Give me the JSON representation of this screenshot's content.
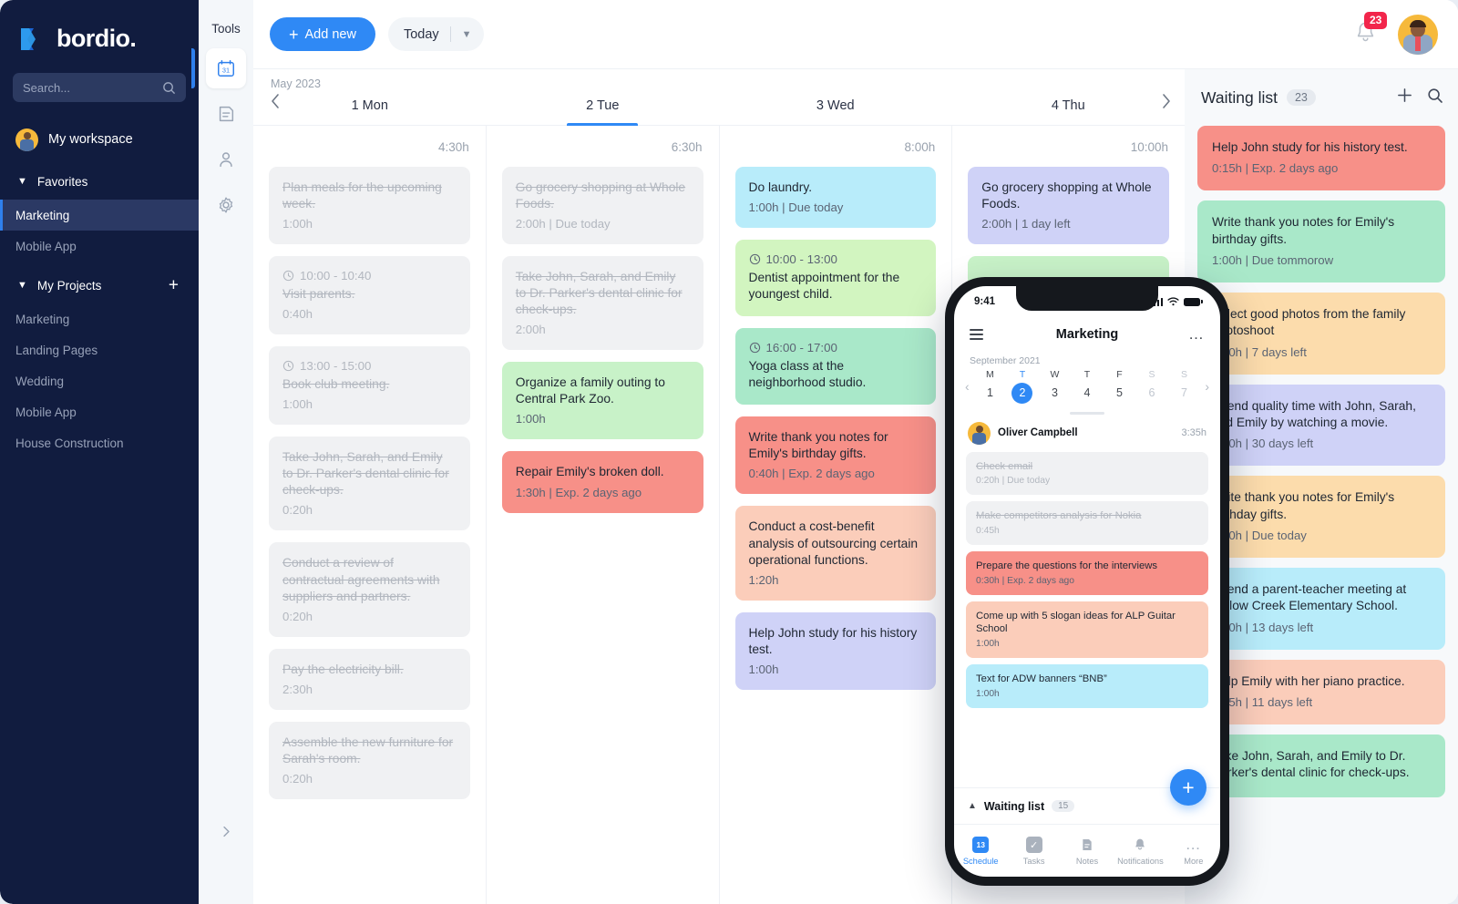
{
  "sidebar": {
    "brand": "bordio.",
    "search_placeholder": "Search...",
    "workspace": "My workspace",
    "favorites_label": "Favorites",
    "favorites": [
      {
        "label": "Marketing",
        "active": true
      },
      {
        "label": "Mobile App",
        "active": false
      }
    ],
    "projects_label": "My Projects",
    "add_project_icon": "plus-icon",
    "projects": [
      {
        "label": "Marketing"
      },
      {
        "label": "Landing Pages"
      },
      {
        "label": "Wedding"
      },
      {
        "label": "Mobile App"
      },
      {
        "label": "House Construction"
      }
    ]
  },
  "tools_rail": {
    "label": "Tools",
    "items": [
      {
        "icon": "calendar-31-icon",
        "active": true
      },
      {
        "icon": "notes-icon",
        "active": false
      },
      {
        "icon": "contacts-icon",
        "active": false
      },
      {
        "icon": "gear-icon",
        "active": false
      }
    ],
    "expand_icon": "chevron-right-icon"
  },
  "topbar": {
    "add_new_label": "Add new",
    "today_label": "Today",
    "notifications_count": "23"
  },
  "daynav": {
    "month": "May 2023",
    "prev_icon": "chevron-left-icon",
    "next_icon": "chevron-right-icon",
    "days": [
      {
        "label": "1 Mon",
        "selected": false
      },
      {
        "label": "2 Tue",
        "selected": true
      },
      {
        "label": "3 Wed",
        "selected": false
      },
      {
        "label": "4 Thu",
        "selected": false
      }
    ]
  },
  "columns": [
    {
      "total": "4:30h",
      "cards": [
        {
          "title": "Plan meals for the upcoming week.",
          "meta": "1:00h",
          "time": "",
          "color": "#f0f1f3",
          "done": true
        },
        {
          "title": "Visit parents.",
          "meta": "0:40h",
          "time": "10:00 - 10:40",
          "color": "#f0f1f3",
          "done": true
        },
        {
          "title": "Book club meeting.",
          "meta": "1:00h",
          "time": "13:00 - 15:00",
          "color": "#f0f1f3",
          "done": true
        },
        {
          "title": "Take John, Sarah, and Emily to Dr. Parker's dental clinic for check-ups.",
          "meta": "0:20h",
          "time": "",
          "color": "#f0f1f3",
          "done": true
        },
        {
          "title": "Conduct a review of contractual agreements with suppliers and partners.",
          "meta": "0:20h",
          "time": "",
          "color": "#f0f1f3",
          "done": true
        },
        {
          "title": "Pay the electricity bill.",
          "meta": "2:30h",
          "time": "",
          "color": "#f0f1f3",
          "done": true
        },
        {
          "title": "Assemble the new furniture for Sarah's room.",
          "meta": "0:20h",
          "time": "",
          "color": "#f0f1f3",
          "done": true
        }
      ]
    },
    {
      "total": "6:30h",
      "cards": [
        {
          "title": "Go grocery shopping at Whole Foods.",
          "meta": "2:00h | Due today",
          "time": "",
          "color": "#f0f1f3",
          "done": true
        },
        {
          "title": "Take John, Sarah, and Emily to Dr. Parker's dental clinic for check-ups.",
          "meta": "2:00h",
          "time": "",
          "color": "#f0f1f3",
          "done": true
        },
        {
          "title": "Organize a family outing to Central Park Zoo.",
          "meta": "1:00h",
          "time": "",
          "color": "#c8f2c8",
          "done": false
        },
        {
          "title": "Repair Emily's broken doll.",
          "meta": "1:30h | Exp. 2 days ago",
          "time": "",
          "color": "#f79088",
          "done": false
        }
      ]
    },
    {
      "total": "8:00h",
      "cards": [
        {
          "title": "Do laundry.",
          "meta": "1:00h | Due today",
          "time": "",
          "color": "#b8ecfa",
          "done": false
        },
        {
          "title": "Dentist appointment for the youngest child.",
          "meta": "",
          "time": "10:00 - 13:00",
          "color": "#d2f5c0",
          "done": false
        },
        {
          "title": "Yoga class at the neighborhood studio.",
          "meta": "",
          "time": "16:00 - 17:00",
          "color": "#a9e8c9",
          "done": false
        },
        {
          "title": "Write thank you notes for Emily's birthday gifts.",
          "meta": "0:40h | Exp. 2 days ago",
          "time": "",
          "color": "#f79088",
          "done": false
        },
        {
          "title": "Conduct a cost-benefit analysis of outsourcing certain operational functions.",
          "meta": "1:20h",
          "time": "",
          "color": "#fbcdba",
          "done": false
        },
        {
          "title": "Help John study for his history test.",
          "meta": "1:00h",
          "time": "",
          "color": "#cfd2f7",
          "done": false
        }
      ]
    },
    {
      "total": "10:00h",
      "cards": [
        {
          "title": "Go grocery shopping at Whole Foods.",
          "meta": "2:00h | 1 day left",
          "time": "",
          "color": "#cfd2f7",
          "done": false
        },
        {
          "title": "",
          "meta": "",
          "time": "",
          "color": "#c8f2c8",
          "done": false
        }
      ]
    }
  ],
  "waiting_list": {
    "title": "Waiting list",
    "count": "23",
    "add_icon": "plus-icon",
    "search_icon": "search-icon",
    "cards": [
      {
        "title": "Help John study for his history test.",
        "meta": "0:15h | Exp. 2 days ago",
        "color": "#f79088"
      },
      {
        "title": "Write thank you notes for Emily's birthday gifts.",
        "meta": "1:00h | Due tommorow",
        "color": "#a9e8c9"
      },
      {
        "title": "Select good photos from the family photoshoot",
        "meta": "0:30h | 7 days left",
        "color": "#fcdcac"
      },
      {
        "title": "Spend quality time with John, Sarah, and Emily by watching a movie.",
        "meta": "2:00h | 30 days left",
        "color": "#cfd2f7"
      },
      {
        "title": "Write thank you notes for Emily's birthday gifts.",
        "meta": "0:40h | Due today",
        "color": "#fcdcac"
      },
      {
        "title": "Attend a parent-teacher meeting at Willow Creek Elementary School.",
        "meta": "1:00h | 13 days left",
        "color": "#b8ecfa"
      },
      {
        "title": "Help Emily with her piano practice.",
        "meta": "0:45h | 11 days left",
        "color": "#fbcdba"
      },
      {
        "title": "Take John, Sarah, and Emily to Dr. Parker's dental clinic for check-ups.",
        "meta": "",
        "color": "#a9e8c9"
      }
    ]
  },
  "phone": {
    "status_time": "9:41",
    "header_title": "Marketing",
    "menu_icon": "hamburger-icon",
    "more_icon": "more-dots-icon",
    "month": "September 2021",
    "week": [
      {
        "letter": "M",
        "num": "1",
        "selected": false,
        "weekend": false
      },
      {
        "letter": "T",
        "num": "2",
        "selected": true,
        "weekend": false
      },
      {
        "letter": "W",
        "num": "3",
        "selected": false,
        "weekend": false
      },
      {
        "letter": "T",
        "num": "4",
        "selected": false,
        "weekend": false
      },
      {
        "letter": "F",
        "num": "5",
        "selected": false,
        "weekend": false
      },
      {
        "letter": "S",
        "num": "6",
        "selected": false,
        "weekend": true
      },
      {
        "letter": "S",
        "num": "7",
        "selected": false,
        "weekend": true
      }
    ],
    "user_name": "Oliver Campbell",
    "user_hours": "3:35h",
    "cards": [
      {
        "title": "Check email",
        "meta": "0:20h | Due today",
        "color": "#f0f1f3",
        "done": true
      },
      {
        "title": "Make competitors analysis for Nokia",
        "meta": "0:45h",
        "color": "#f0f1f3",
        "done": true
      },
      {
        "title": "Prepare the questions for the interviews",
        "meta": "0:30h | Exp. 2 days ago",
        "color": "#f79088",
        "done": false
      },
      {
        "title": "Come up with 5 slogan ideas for ALP Guitar School",
        "meta": "1:00h",
        "color": "#fbcdba",
        "done": false
      },
      {
        "title": "Text for ADW banners “BNB”",
        "meta": "1:00h",
        "color": "#b8ecfa",
        "done": false
      }
    ],
    "waiting_label": "Waiting list",
    "waiting_count": "15",
    "fab_icon": "plus-icon",
    "tabs": [
      {
        "label": "Schedule",
        "icon": "calendar-13-icon",
        "selected": true
      },
      {
        "label": "Tasks",
        "icon": "check-icon",
        "selected": false
      },
      {
        "label": "Notes",
        "icon": "notes-icon",
        "selected": false
      },
      {
        "label": "Notifications",
        "icon": "bell-icon",
        "selected": false
      },
      {
        "label": "More",
        "icon": "more-dots-icon",
        "selected": false
      }
    ]
  }
}
